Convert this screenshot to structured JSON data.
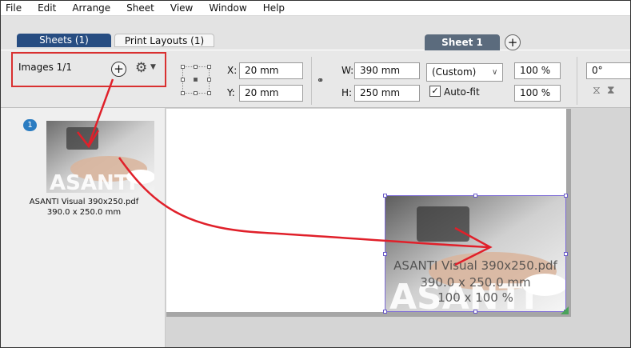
{
  "menu": [
    "File",
    "Edit",
    "Arrange",
    "Sheet",
    "View",
    "Window",
    "Help"
  ],
  "tabs": {
    "sheets": "Sheets (1)",
    "print_layouts": "Print Layouts (1)",
    "sheet1": "Sheet 1",
    "add": "+"
  },
  "toolbar": {
    "images_label": "Images 1/1",
    "add_symbol": "+",
    "x_label": "X:",
    "x_value": "20 mm",
    "y_label": "Y:",
    "y_value": "20 mm",
    "w_label": "W:",
    "w_value": "390 mm",
    "h_label": "H:",
    "h_value": "250 mm",
    "preset": "(Custom)",
    "scale_x": "100 %",
    "scale_y": "100 %",
    "autofit_label": "Auto-fit",
    "autofit_checked": true,
    "rotation": "0°"
  },
  "thumbnail": {
    "badge": "1",
    "caption_name": "ASANTI Visual 390x250.pdf",
    "caption_size": "390.0 x 250.0 mm"
  },
  "placed": {
    "name": "ASANTI Visual 390x250.pdf",
    "size": "390.0 x 250.0 mm",
    "scale": "100 x 100 %"
  },
  "colors": {
    "highlight": "#d93030",
    "arrow": "#e0202a",
    "active_tab": "#274d82",
    "selection": "#7d6bd6"
  }
}
